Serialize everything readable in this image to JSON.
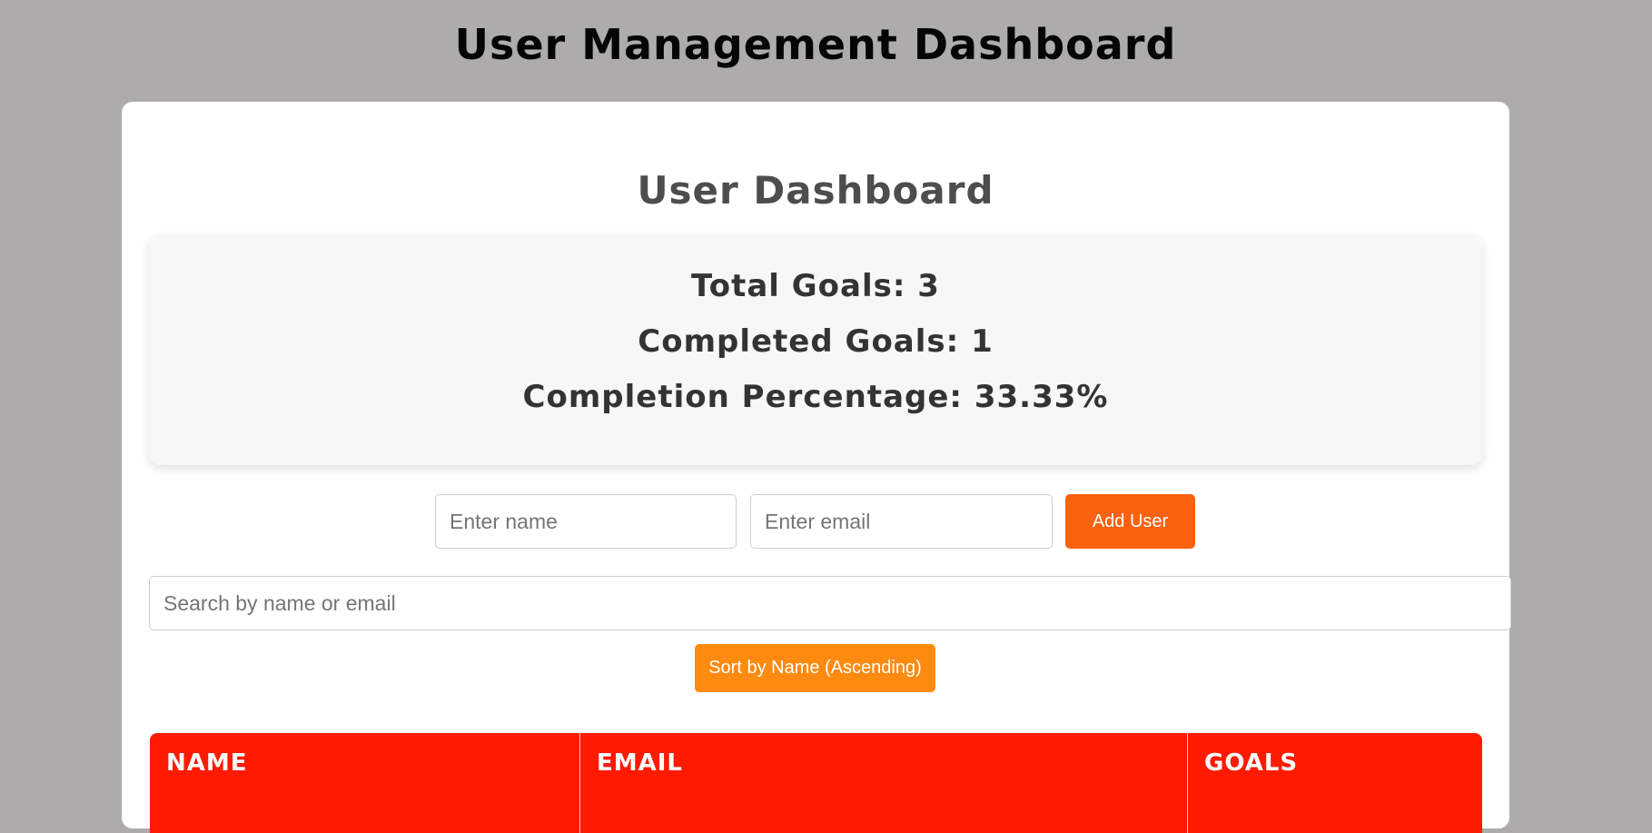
{
  "app": {
    "title": "User Management Dashboard"
  },
  "dashboard": {
    "title": "User Dashboard",
    "stats": {
      "total_goals": "Total Goals: 3",
      "completed_goals": "Completed Goals: 1",
      "completion_percentage": "Completion Percentage: 33.33%"
    }
  },
  "add_user_form": {
    "name_placeholder": "Enter name",
    "email_placeholder": "Enter email",
    "submit_label": "Add User"
  },
  "search": {
    "placeholder": "Search by name or email"
  },
  "sort": {
    "label": "Sort by Name (Ascending)"
  },
  "table": {
    "columns": [
      "Name",
      "Email",
      "Goals"
    ]
  },
  "colors": {
    "background": "#adacab",
    "card": "#ffffff",
    "add_button": "#f9620e",
    "sort_button": "#fe8a0f",
    "table_header": "#ff1a00"
  }
}
